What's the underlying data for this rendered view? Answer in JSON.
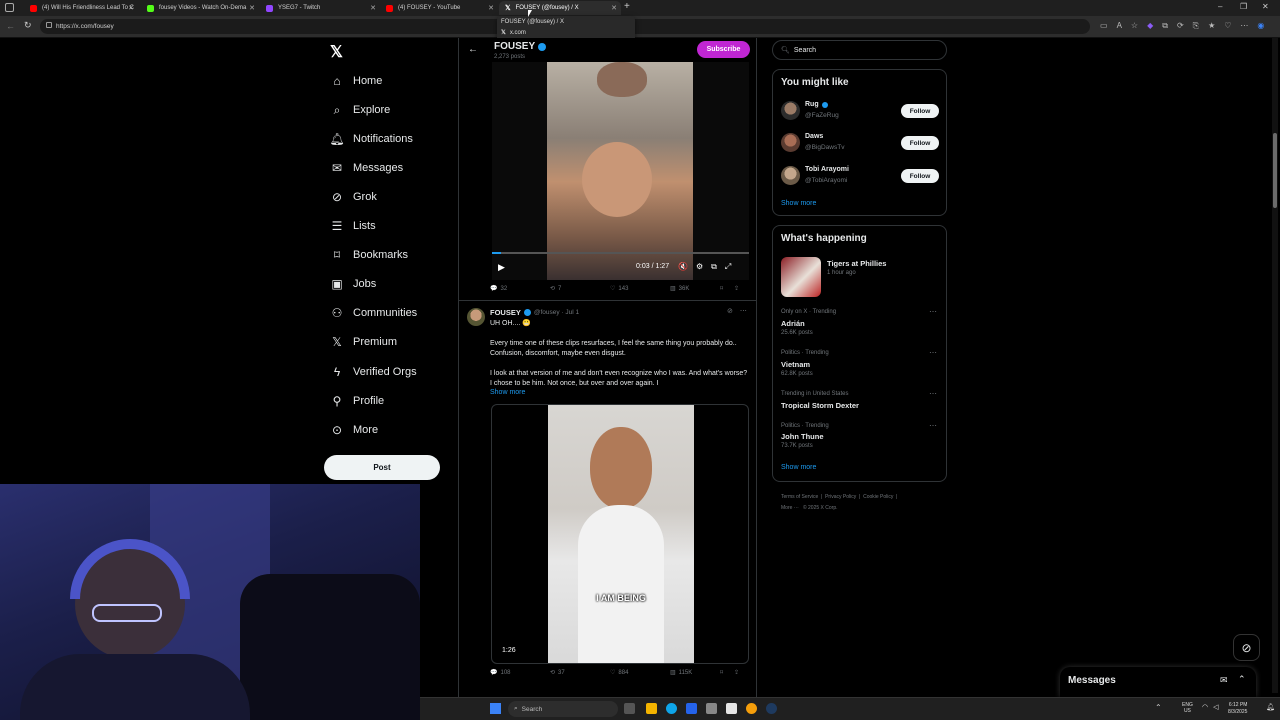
{
  "browser": {
    "tabs": [
      {
        "title": "(4) Will His Friendliness Lead To C",
        "color": "#ff0000"
      },
      {
        "title": "fousey Videos - Watch On-Dema",
        "color": "#53fc18"
      },
      {
        "title": "YSEG7 - Twitch",
        "color": "#9146ff"
      },
      {
        "title": "(4) FOUSEY - YouTube",
        "color": "#ff0000"
      },
      {
        "title": "FOUSEY (@fousey) / X",
        "color": "#ffffff",
        "active": true
      }
    ],
    "new_tab": "+",
    "tooltip": {
      "title": "FOUSEY (@fousey) / X",
      "domain": "x.com"
    },
    "url": "https://x.com/fousey"
  },
  "nav": {
    "items": [
      {
        "label": "Home",
        "icon": "home-icon"
      },
      {
        "label": "Explore",
        "icon": "search-icon"
      },
      {
        "label": "Notifications",
        "icon": "bell-icon"
      },
      {
        "label": "Messages",
        "icon": "mail-icon"
      },
      {
        "label": "Grok",
        "icon": "grok-icon"
      },
      {
        "label": "Lists",
        "icon": "list-icon"
      },
      {
        "label": "Bookmarks",
        "icon": "bookmark-icon"
      },
      {
        "label": "Jobs",
        "icon": "briefcase-icon"
      },
      {
        "label": "Communities",
        "icon": "people-icon"
      },
      {
        "label": "Premium",
        "icon": "x-logo-icon"
      },
      {
        "label": "Verified Orgs",
        "icon": "bolt-icon"
      },
      {
        "label": "Profile",
        "icon": "person-icon"
      },
      {
        "label": "More",
        "icon": "more-circle-icon"
      }
    ],
    "post_label": "Post"
  },
  "profile_header": {
    "name": "FOUSEY",
    "posts": "2,273 posts",
    "subscribe_label": "Subscribe"
  },
  "video1": {
    "time": "0:03 / 1:27",
    "progress": 0.035,
    "stats": {
      "replies": "32",
      "reposts": "7",
      "likes": "143",
      "views": "36K"
    }
  },
  "tweet2": {
    "name": "FOUSEY",
    "handle": "@fousey · Jul 1",
    "line1": "UH OH.... 😬",
    "p1": "Every time one of these clips resurfaces, I feel the same thing you probably do.. Confusion, discomfort, maybe even disgust.",
    "p2": "I look at that version of me and don't even recognize who I was. And what's worse? I chose to be him. Not once, but over and over again. I",
    "show_more": "Show more",
    "caption": "I AM BEING",
    "duration": "1:26",
    "stats": {
      "replies": "108",
      "reposts": "37",
      "likes": "884",
      "views": "115K"
    }
  },
  "search": {
    "placeholder": "Search"
  },
  "you_might_like": {
    "title": "You might like",
    "users": [
      {
        "name": "Rug",
        "handle": "@FaZeRug",
        "verified": true
      },
      {
        "name": "Daws",
        "handle": "@BigDawsTv",
        "verified": false
      },
      {
        "name": "Tobi Arayomi",
        "handle": "@TobiArayomi",
        "verified": false
      }
    ],
    "follow_label": "Follow",
    "show_more": "Show more"
  },
  "whats_happening": {
    "title": "What's happening",
    "featured": {
      "title": "Tigers at Phillies",
      "time": "1 hour ago"
    },
    "trends": [
      {
        "context": "Only on X · Trending",
        "name": "Adrián",
        "count": "25.6K posts"
      },
      {
        "context": "Politics · Trending",
        "name": "Vietnam",
        "count": "62.8K posts"
      },
      {
        "context": "Trending in United States",
        "name": "Tropical Storm Dexter",
        "count": ""
      },
      {
        "context": "Politics · Trending",
        "name": "John Thune",
        "count": "73.7K posts"
      }
    ],
    "show_more": "Show more"
  },
  "footer": {
    "links": [
      "Terms of Service",
      "Privacy Policy",
      "Cookie Policy",
      "More ···",
      "© 2025 X Corp."
    ]
  },
  "messages_drawer": {
    "title": "Messages"
  },
  "taskbar": {
    "search_placeholder": "Search",
    "lang": "ENG",
    "region": "US",
    "time": "6:12 PM",
    "date": "8/3/2025"
  },
  "colors": {
    "accent": "#1d9bf0",
    "subscribe": "#c026d3",
    "background": "#000000"
  }
}
